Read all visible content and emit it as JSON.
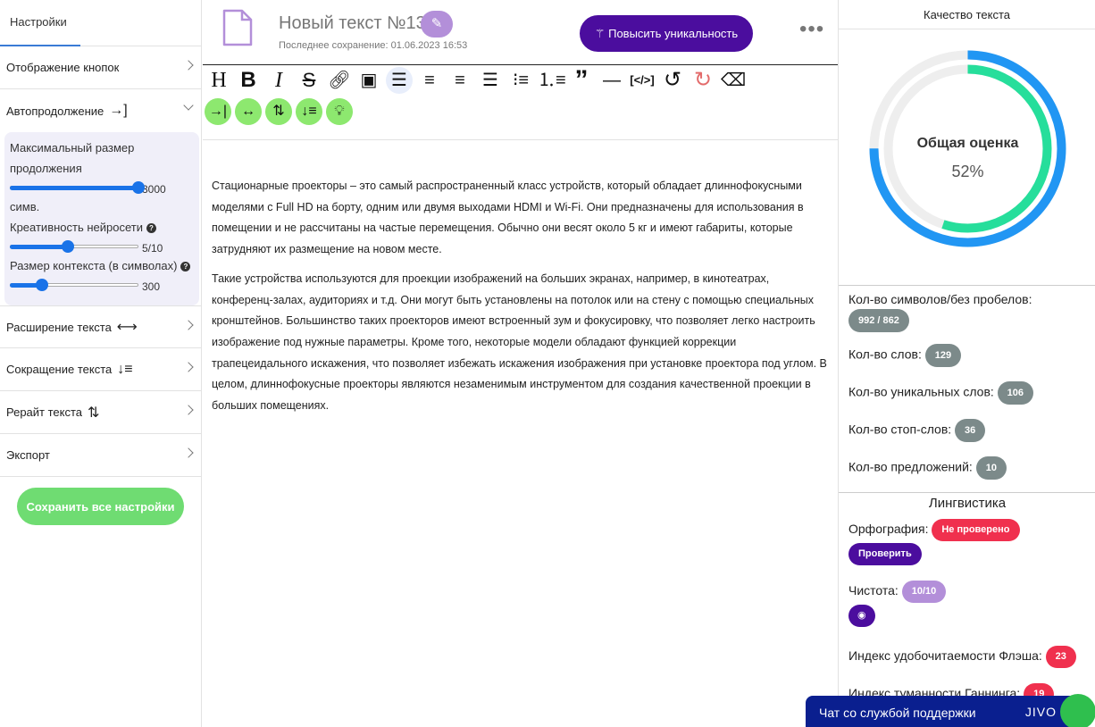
{
  "sidebar": {
    "tab": "Настройки",
    "items": [
      {
        "label": "Отображение кнопок"
      },
      {
        "label": "Автопродолжение",
        "icon": "→]"
      },
      {
        "label": "Расширение текста",
        "icon": "⟷"
      },
      {
        "label": "Сокращение текста",
        "icon": "↓≡"
      },
      {
        "label": "Рерайт текста",
        "icon": "⇅"
      },
      {
        "label": "Экспорт"
      }
    ],
    "auto": {
      "max_size_label": "Максимальный размер продолжения",
      "max_size_value": "3000",
      "max_size_unit": "симв.",
      "max_size_fraction": 1.0,
      "creativity_label": "Креативность нейросети",
      "creativity_value": "5/10",
      "creativity_fraction": 0.45,
      "context_label": "Размер контекста (в символах)",
      "context_value": "300",
      "context_fraction": 0.25
    },
    "save_all": "Сохранить все настройки"
  },
  "doc": {
    "title": "Новый текст №13",
    "saved": "Последнее сохранение: 01.06.2023 16:53",
    "uniq_button": "Повысить уникальность",
    "paragraphs": [
      "Стационарные проекторы – это самый распространенный класс устройств, который обладает длиннофокусными моделями с Full HD на борту, одним или двумя выходами HDMI и Wi-Fi. Они предназначены для использования в помещении и не рассчитаны на частые перемещения. Обычно они весят около 5 кг и имеют габариты, которые затрудняют их размещение на новом месте.",
      "Такие устройства используются для проекции изображений на больших экранах, например, в кинотеатрах, конференц-залах, аудиториях и т.д. Они могут быть установлены на потолок или на стену с помощью специальных кронштейнов. Большинство таких проекторов имеют встроенный зум и фокусировку, что позволяет легко настроить изображение под нужные параметры. Кроме того, некоторые модели обладают функцией коррекции трапецеидального искажения, что позволяет избежать искажения изображения при установке проектора под углом. В целом, длиннофокусные проекторы являются незаменимым инструментом для создания качественной проекции в больших помещениях."
    ]
  },
  "quality": {
    "header": "Качество текста",
    "gauge_title": "Общая оценка",
    "gauge_value": "52%",
    "outer_fraction": 0.75,
    "inner_fraction": 0.55,
    "stats": [
      {
        "label": "Кол-во символов/без пробелов:",
        "value": "992 / 862"
      },
      {
        "label": "Кол-во слов:",
        "value": "129"
      },
      {
        "label": "Кол-во уникальных слов:",
        "value": "106"
      },
      {
        "label": "Кол-во стоп-слов:",
        "value": "36"
      },
      {
        "label": "Кол-во предложений:",
        "value": "10"
      }
    ]
  },
  "linguistics": {
    "header": "Лингвистика",
    "spelling_label": "Орфография:",
    "spelling_status": "Не проверено",
    "check_button": "Проверить",
    "purity_label": "Чистота:",
    "purity_value": "10/10",
    "flesch_label": "Индекс удобочитаемости Флэша:",
    "flesch_value": "23",
    "gunning_label": "Индекс туманности Ганнинга:",
    "gunning_value": "19"
  },
  "chat": {
    "label": "Чат со службой поддержки",
    "brand": "JIVO"
  },
  "colors": {
    "accent": "#4b0d9e",
    "green": "#6fdc72",
    "blue_ring": "#2196f3",
    "teal_ring": "#26de9b",
    "red_badge": "#f0304e",
    "grey_badge": "#7c8a8a"
  }
}
